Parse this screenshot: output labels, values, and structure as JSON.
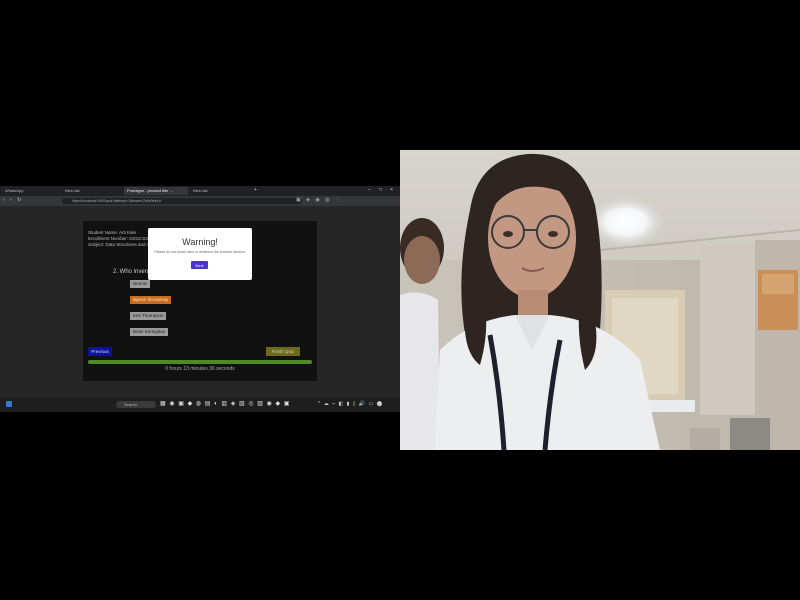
{
  "browser": {
    "tabs": [
      {
        "label": "WhatsApp",
        "active": false
      },
      {
        "label": "New tab",
        "active": false
      },
      {
        "label": "Prototype - product title ...",
        "active": true
      },
      {
        "label": "New tab",
        "active": false
      }
    ],
    "new_tab": "+",
    "window_controls": [
      "–",
      "□",
      "×"
    ],
    "nav_icons": "‹ › ↻",
    "url": "https://localhost:3000/quiz?attempt=1&exam=2b9c0e4e1f"
  },
  "quiz": {
    "student_name_label": "Student Name: Arti Kale",
    "enrollment_label": "Enrollment Number: 0101CS2101",
    "subject_label": "Subject: Data Structures and Algorithms",
    "question": "2. Who invented C++?",
    "options": [
      {
        "label": "Dennis"
      },
      {
        "label": "Bjarne Stroustrup",
        "selected": true
      },
      {
        "label": "Ken Thompson"
      },
      {
        "label": "Brian Kernighan"
      }
    ],
    "prev_button": "Previous",
    "finish_button": "Finish Quiz",
    "progress": 1.0,
    "timer": "0 hours 13 minutes 36 seconds"
  },
  "warning_modal": {
    "title": "Warning!",
    "message": "Please do not switch tabs or minimize the browser window.",
    "button": "Next"
  },
  "taskbar": {
    "search_placeholder": "Search",
    "app_icons": "▦ ◉ ▣ ◆ ◍ ▤ ◐ ▥ ◈ ▧ ◎ ▨ ◉ ◆ ▣",
    "tray": "^ ☁ ⌁ ◧ ▮ ▯ 🔊 ▭ ⬤"
  },
  "colors": {
    "modal_button": "#4a35c9",
    "selected_option": "#c86b1e",
    "progress": "#4f8a22",
    "prev_button": "#1010a0",
    "finish_button": "#6e6a1c"
  }
}
